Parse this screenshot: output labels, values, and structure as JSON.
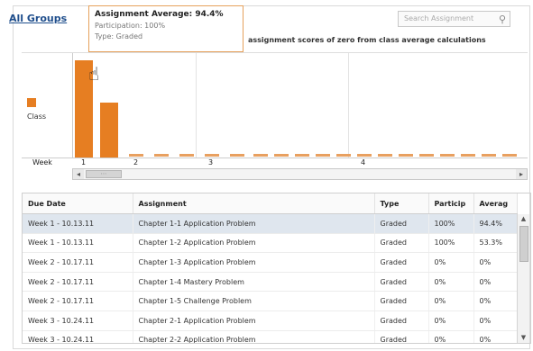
{
  "header": {
    "all_groups": "All Groups",
    "notice": "assignment scores of zero from class average calculations",
    "search_placeholder": "Search Assignment"
  },
  "tooltip": {
    "title": "Assignment Average: 94.4%",
    "participation": "Participation: 100%",
    "type": "Type: Graded"
  },
  "chart_data": {
    "type": "bar",
    "title": "",
    "xlabel": "Week",
    "ylabel": "",
    "legend": [
      "Class"
    ],
    "x_ticks": [
      "1",
      "2",
      "3",
      "4"
    ],
    "categories": [
      "Chapter 1-1 Application Problem",
      "Chapter 1-2 Application Problem",
      "Chapter 1-3 Application Problem",
      "Chapter 1-4 Mastery Problem",
      "Chapter 1-5 Challenge Problem",
      "Chapter 2-1 Application Problem",
      "Chapter 2-2 Application Problem"
    ],
    "values": [
      94.4,
      53.3,
      0,
      0,
      0,
      0,
      0
    ],
    "ylim": [
      0,
      100
    ]
  },
  "table": {
    "columns": [
      "Due Date",
      "Assignment",
      "Type",
      "Particip",
      "Averag"
    ],
    "rows": [
      [
        "Week 1 - 10.13.11",
        "Chapter 1-1 Application Problem",
        "Graded",
        "100%",
        "94.4%"
      ],
      [
        "Week 1 - 10.13.11",
        "Chapter 1-2 Application Problem",
        "Graded",
        "100%",
        "53.3%"
      ],
      [
        "Week 2 - 10.17.11",
        "Chapter 1-3 Application Problem",
        "Graded",
        "0%",
        "0%"
      ],
      [
        "Week 2 - 10.17.11",
        "Chapter 1-4 Mastery Problem",
        "Graded",
        "0%",
        "0%"
      ],
      [
        "Week 2 - 10.17.11",
        "Chapter 1-5 Challenge Problem",
        "Graded",
        "0%",
        "0%"
      ],
      [
        "Week 3 - 10.24.11",
        "Chapter 2-1 Application Problem",
        "Graded",
        "0%",
        "0%"
      ],
      [
        "Week 3 - 10.24.11",
        "Chapter 2-2 Application Problem",
        "Graded",
        "0%",
        "0%"
      ]
    ]
  },
  "colors": {
    "bar": "#e67e22",
    "link": "#1f4e8c",
    "selected_row": "#dfe6ee"
  },
  "icons": {
    "search": "magnifier-icon",
    "cursor": "hand-pointer-icon"
  }
}
